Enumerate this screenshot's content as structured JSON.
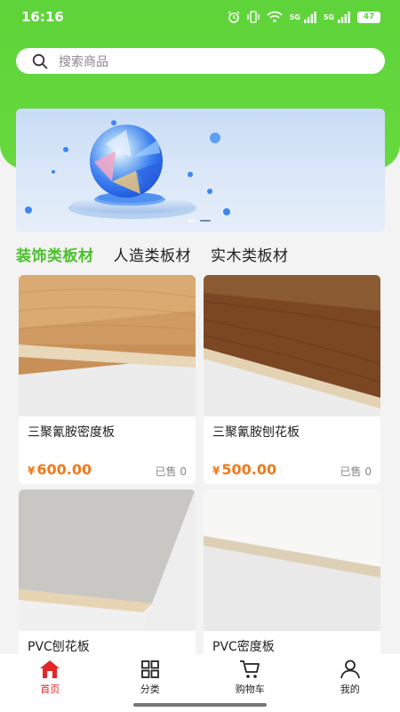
{
  "status": {
    "time": "16:16",
    "net1": "5G",
    "net2": "5G",
    "battery": "47"
  },
  "search": {
    "placeholder": "搜索商品",
    "icon": "search-icon"
  },
  "banner": {
    "slides": 2,
    "active_slide": 1
  },
  "tabs": [
    {
      "label": "装饰类板材",
      "active": true
    },
    {
      "label": "人造类板材",
      "active": false
    },
    {
      "label": "实木类板材",
      "active": false
    }
  ],
  "products": [
    {
      "name": "三聚氰胺密度板",
      "currency": "¥",
      "price": "600.00",
      "sold": "已售 0"
    },
    {
      "name": "三聚氰胺刨花板",
      "currency": "¥",
      "price": "500.00",
      "sold": "已售 0"
    },
    {
      "name": "PVC刨花板",
      "currency": "¥",
      "price": "",
      "sold": ""
    },
    {
      "name": "PVC密度板",
      "currency": "¥",
      "price": "",
      "sold": ""
    }
  ],
  "nav": [
    {
      "label": "首页",
      "icon": "home-icon",
      "active": true
    },
    {
      "label": "分类",
      "icon": "grid-icon",
      "active": false
    },
    {
      "label": "购物车",
      "icon": "cart-icon",
      "active": false
    },
    {
      "label": "我的",
      "icon": "user-icon",
      "active": false
    }
  ],
  "colors": {
    "primary_green": "#5ed43a",
    "tab_active": "#4ac12b",
    "price": "#f07a1a",
    "nav_active": "#e3262a"
  }
}
